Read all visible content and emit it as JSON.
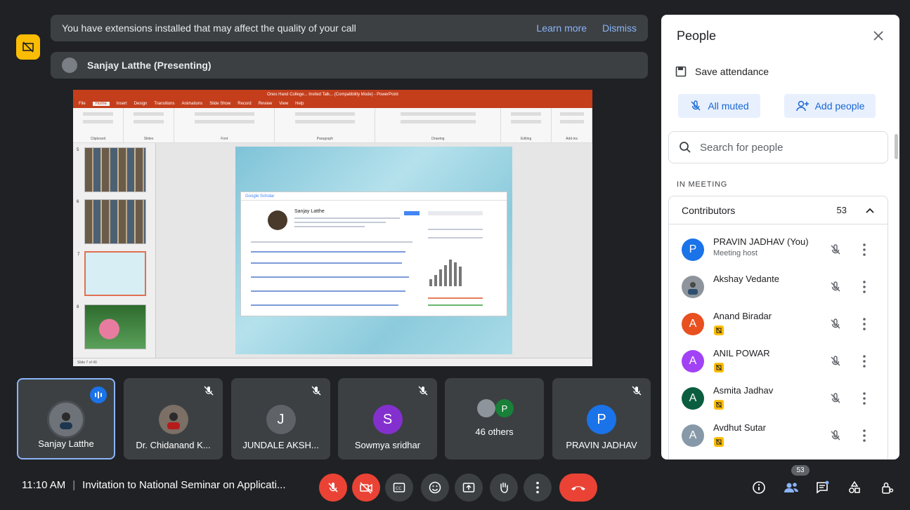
{
  "banner": {
    "message": "You have extensions installed that may affect the quality of your call",
    "learn_more": "Learn more",
    "dismiss": "Dismiss"
  },
  "presenting": {
    "label": "Sanjay Latthe (Presenting)"
  },
  "slide_preview": {
    "ppt_title": "Ones Hand College... Invited Talk... (Compatibility Mode) - PowerPoint",
    "ribbon_tabs": [
      "File",
      "Home",
      "Insert",
      "Design",
      "Transitions",
      "Animations",
      "Slide Show",
      "Record",
      "Review",
      "View",
      "Help"
    ],
    "ribbon_groups": [
      "Clipboard",
      "Slides",
      "Font",
      "Paragraph",
      "Drawing",
      "Editing",
      "Add-ins"
    ],
    "thumb_numbers": [
      "5",
      "6",
      "7",
      "8"
    ],
    "scholar_header": "Google Scholar",
    "scholar_name": "Sanjay Latthe",
    "status": "Slide 7 of 40"
  },
  "tiles": [
    {
      "name": "Sanjay Latthe",
      "initial": "",
      "color": "#5f6368"
    },
    {
      "name": "Dr. Chidanand K...",
      "initial": "",
      "color": "#7b6f66"
    },
    {
      "name": "JUNDALE AKSH...",
      "initial": "J",
      "color": "#5f6368"
    },
    {
      "name": "Sowmya sridhar",
      "initial": "S",
      "color": "#8430ce"
    },
    {
      "name": "46 others",
      "initial": "P",
      "color": "#188038"
    },
    {
      "name": "PRAVIN JADHAV",
      "initial": "P",
      "color": "#1a73e8"
    }
  ],
  "people_panel": {
    "title": "People",
    "save_attendance": "Save attendance",
    "all_muted": "All muted",
    "add_people": "Add people",
    "search_placeholder": "Search for people",
    "in_meeting": "IN MEETING",
    "contributors_label": "Contributors",
    "contributors_count": "53",
    "people": [
      {
        "name": "PRAVIN JADHAV (You)",
        "sub": "Meeting host",
        "initial": "P",
        "color": "#1a73e8"
      },
      {
        "name": "Akshay Vedante",
        "sub": "",
        "initial": "",
        "color": "#8d949b"
      },
      {
        "name": "Anand Biradar",
        "sub": "",
        "initial": "A",
        "color": "#e8501f"
      },
      {
        "name": "ANIL POWAR",
        "sub": "",
        "initial": "A",
        "color": "#a142f4"
      },
      {
        "name": "Asmita Jadhav",
        "sub": "",
        "initial": "A",
        "color": "#0b5d3f"
      },
      {
        "name": "Avdhut Sutar",
        "sub": "",
        "initial": "A",
        "color": "#8799a8"
      }
    ]
  },
  "bottom": {
    "time": "11:10 AM",
    "separator": "|",
    "meeting_title": "Invitation to National Seminar on Applicati...",
    "people_count": "53"
  }
}
